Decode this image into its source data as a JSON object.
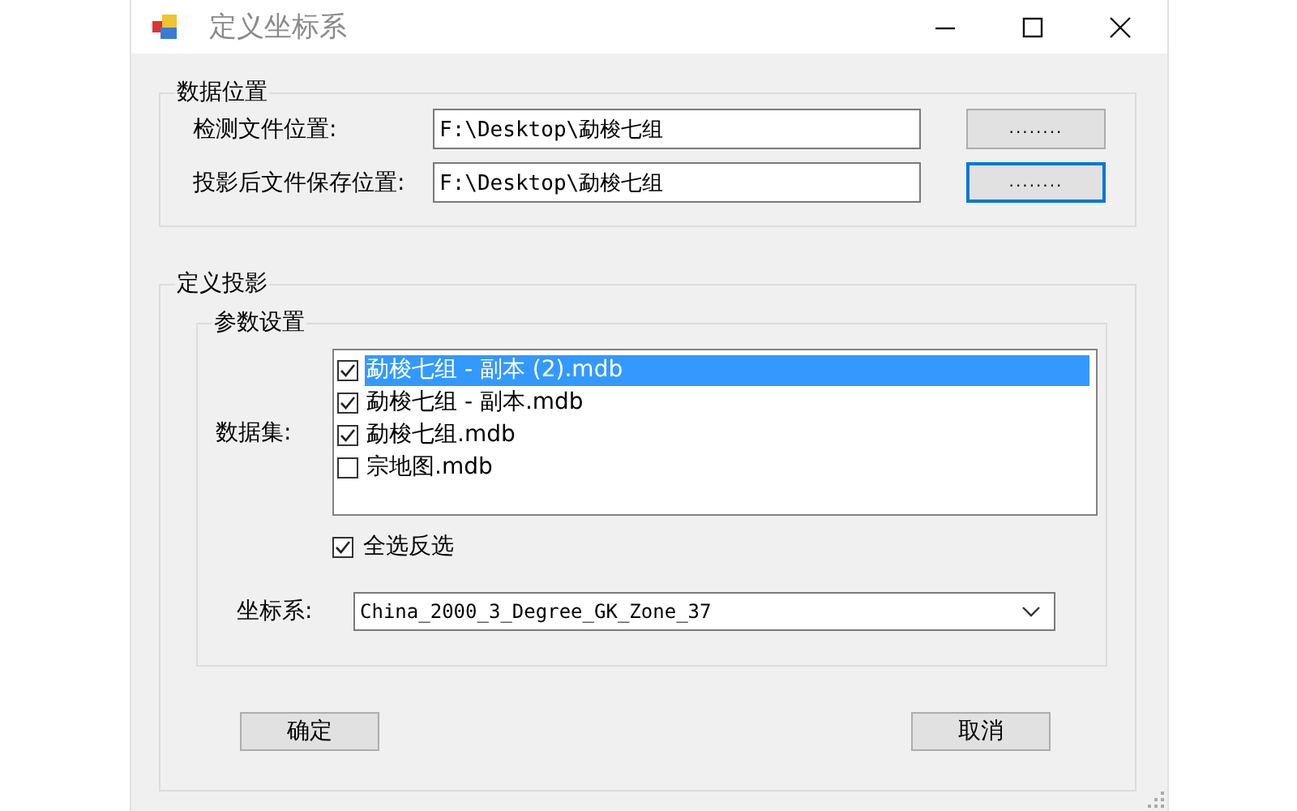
{
  "window": {
    "title": "定义坐标系"
  },
  "data_location": {
    "title": "数据位置",
    "fields": [
      {
        "label": "检测文件位置:",
        "value": "F:\\Desktop\\勐梭七组",
        "button": "........",
        "focused": false
      },
      {
        "label": "投影后文件保存位置:",
        "value": "F:\\Desktop\\勐梭七组",
        "button": "........",
        "focused": true
      }
    ]
  },
  "projection": {
    "title": "定义投影",
    "params": {
      "title": "参数设置",
      "dataset_label": "数据集:",
      "datasets": [
        {
          "name": "勐梭七组 - 副本 (2).mdb",
          "checked": true,
          "selected": true
        },
        {
          "name": "勐梭七组 - 副本.mdb",
          "checked": true,
          "selected": false
        },
        {
          "name": "勐梭七组.mdb",
          "checked": true,
          "selected": false
        },
        {
          "name": "宗地图.mdb",
          "checked": false,
          "selected": false
        }
      ],
      "select_all": {
        "label": "全选反选",
        "checked": true
      },
      "crs_label": "坐标系:",
      "crs_value": "China_2000_3_Degree_GK_Zone_37"
    }
  },
  "buttons": [
    "确定",
    "取消"
  ]
}
